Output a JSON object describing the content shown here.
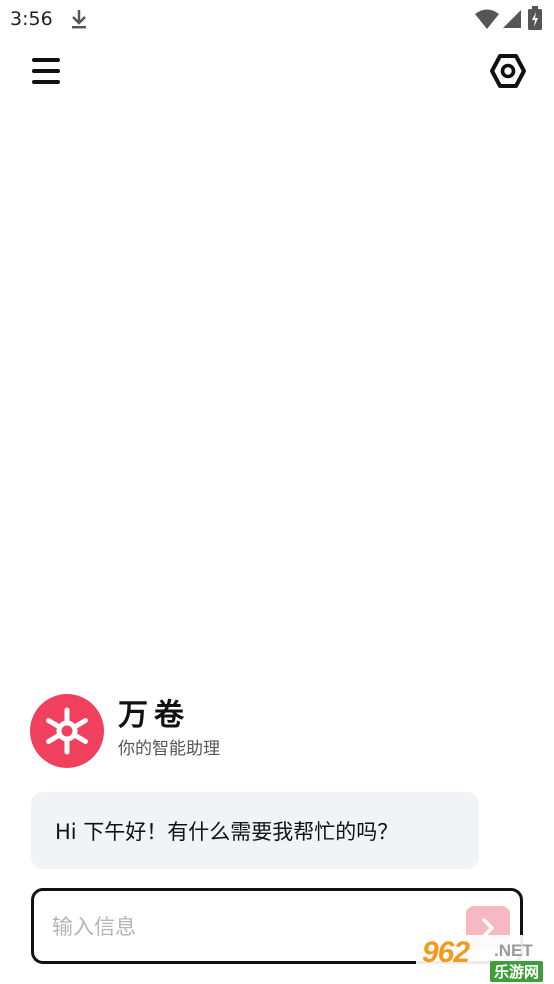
{
  "status_bar": {
    "time": "3:56",
    "icons": [
      "download-icon",
      "wifi-icon",
      "signal-icon",
      "battery-icon"
    ]
  },
  "header": {
    "menu_icon": "hamburger-menu-icon",
    "settings_icon": "hexagon-settings-icon"
  },
  "assistant": {
    "name": "万卷",
    "subtitle": "你的智能助理",
    "avatar_icon": "snowflake-logo-icon",
    "avatar_color": "#f0405e"
  },
  "chat": {
    "greeting": "Hi 下午好！有什么需要我帮忙的吗？"
  },
  "composer": {
    "placeholder": "输入信息",
    "value": "",
    "send_icon": "chevron-right-icon",
    "send_color": "#f6b8c3"
  },
  "watermark": {
    "number": "962",
    "domain": ".NET",
    "label": "乐游网"
  }
}
